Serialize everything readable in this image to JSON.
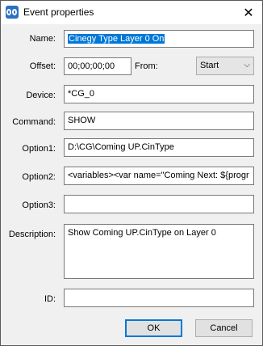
{
  "dialog": {
    "title": "Event properties",
    "close_glyph": "✕",
    "fields": {
      "name": {
        "label": "Name:",
        "value": "Cinegy Type Layer 0 On"
      },
      "offset": {
        "label": "Offset:",
        "value": "00;00;00;00"
      },
      "from": {
        "label": "From:",
        "value": "Start",
        "arrow": "⌵"
      },
      "device": {
        "label": "Device:",
        "value": "*CG_0"
      },
      "command": {
        "label": "Command:",
        "value": "SHOW"
      },
      "option1": {
        "label": "Option1:",
        "value": "D:\\CG\\Coming UP.CinType"
      },
      "option2": {
        "label": "Option2:",
        "value": "<variables><var name=\"Coming Next: ${progr"
      },
      "option3": {
        "label": "Option3:",
        "value": ""
      },
      "description": {
        "label": "Description:",
        "value": "Show Coming UP.CinType on Layer 0"
      },
      "id": {
        "label": "ID:",
        "value": ""
      }
    },
    "buttons": {
      "ok": "OK",
      "cancel": "Cancel"
    }
  }
}
